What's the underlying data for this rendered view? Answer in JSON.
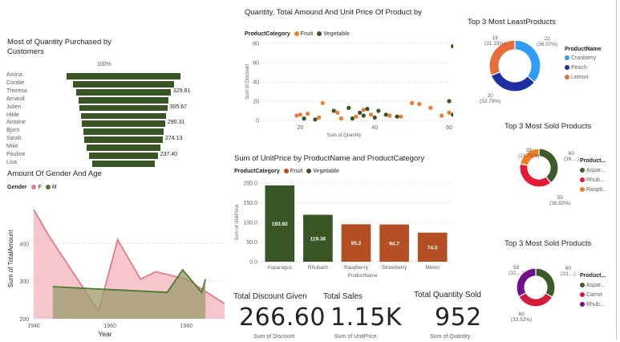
{
  "colors": {
    "dark_green": "#375623",
    "fruit": "#ed7d31",
    "vegetable": "#375623",
    "bar_green": "#375623",
    "bar_brown": "#b34f23",
    "area_f": "#e37c8a",
    "area_f_fill": "#f2b8c0",
    "area_m": "#4a7a2e",
    "cranberry": "#2e9df7",
    "peach": "#1f2ea0",
    "lemon": "#e86d3b",
    "asparagus": "#3b5b2b",
    "rhubarb": "#e31a38",
    "raspberry": "#f57d1f",
    "carrot": "#d61a3c",
    "rhubarb2": "#6f0f8a"
  },
  "funnel": {
    "title": "Most of Quantity Purchased by Customers",
    "top_label": "100%",
    "chart_data": {
      "type": "funnel",
      "categories": [
        "Amina",
        "Coralie",
        "Theresa",
        "Arnaud",
        "Julien",
        "Hilde",
        "Antoine",
        "Bjorn",
        "Sarah",
        "Mike",
        "Pauline",
        "Lisa"
      ],
      "values": [
        100,
        89,
        83,
        79,
        77,
        75,
        73,
        71,
        69,
        65,
        60,
        55
      ],
      "labels": [
        "",
        "",
        "329.81",
        "",
        "305.67",
        "",
        "290.31",
        "",
        "274.13",
        "",
        "237.40",
        ""
      ]
    }
  },
  "area": {
    "title": "Amount Of Gender And Age",
    "legend_title": "Gender",
    "legend": [
      "F",
      "M"
    ],
    "ylabel": "Sum of TotalAmount",
    "xlabel": "Year",
    "chart_data": {
      "type": "area",
      "xlim": [
        1940,
        1990
      ],
      "ylim": [
        200,
        520
      ],
      "x_ticks": [
        1940,
        1960,
        1980
      ],
      "y_ticks": [
        200,
        300,
        400
      ],
      "series": [
        {
          "name": "F",
          "x": [
            1940,
            1944,
            1957,
            1962,
            1968,
            1972,
            1980,
            1990
          ],
          "y": [
            490,
            420,
            220,
            410,
            305,
            325,
            305,
            240
          ]
        },
        {
          "name": "M",
          "x": [
            1945,
            1955,
            1975,
            1979,
            1984,
            1985
          ],
          "y": [
            285,
            280,
            270,
            330,
            270,
            305
          ]
        }
      ]
    }
  },
  "scatter": {
    "title": "Quantity, Total Amound And Unit Price Of Product by",
    "legend_title": "ProductCategory",
    "legend": [
      "Fruit",
      "Vegetable"
    ],
    "ylabel": "Sum of Discount",
    "xlabel": "Sum of Quantity",
    "chart_data": {
      "type": "scatter",
      "xlim": [
        10,
        60
      ],
      "ylim": [
        0,
        80
      ],
      "x_ticks": [
        20,
        40,
        60
      ],
      "y_ticks": [
        0,
        20,
        40,
        60,
        80
      ],
      "series": [
        {
          "name": "Fruit",
          "points": [
            [
              19,
              5
            ],
            [
              20,
              6
            ],
            [
              22,
              7
            ],
            [
              25,
              3
            ],
            [
              26,
              18
            ],
            [
              30,
              8
            ],
            [
              31,
              2
            ],
            [
              35,
              4
            ],
            [
              37,
              11
            ],
            [
              39,
              6
            ],
            [
              44,
              5
            ],
            [
              47,
              4
            ],
            [
              50,
              18
            ],
            [
              52,
              17
            ],
            [
              55,
              13
            ],
            [
              58,
              5
            ],
            [
              60,
              8
            ]
          ]
        },
        {
          "name": "Vegetable",
          "points": [
            [
              21,
              2
            ],
            [
              24,
              1
            ],
            [
              29,
              10
            ],
            [
              33,
              13
            ],
            [
              34,
              2
            ],
            [
              36,
              8
            ],
            [
              37,
              5
            ],
            [
              38,
              12
            ],
            [
              40,
              3
            ],
            [
              41,
              10
            ],
            [
              43,
              6
            ],
            [
              46,
              4
            ],
            [
              60,
              20
            ],
            [
              61,
              77
            ],
            [
              61,
              6
            ]
          ]
        }
      ]
    }
  },
  "bar": {
    "title": "Sum of UnitPrice by ProductName and ProductCategory",
    "legend_title": "ProductCategory",
    "legend": [
      "Fruit",
      "Vegetable"
    ],
    "ylabel": "Sum of UnitPrice",
    "xlabel": "ProductName",
    "chart_data": {
      "type": "bar",
      "categories": [
        "Asparagus",
        "Rhubarb",
        "Raspberry",
        "Strawberry",
        "Melon"
      ],
      "values": [
        193.92,
        119.36,
        95.2,
        94.7,
        74.0
      ],
      "value_labels": [
        "193.92",
        "119.36",
        "95.2",
        "94.7",
        "74.0"
      ],
      "category_type": [
        "Vegetable",
        "Vegetable",
        "Fruit",
        "Fruit",
        "Fruit"
      ],
      "ylim": [
        0,
        200
      ],
      "y_ticks": [
        "0.0",
        "50.0",
        "100.0",
        "150.0",
        "200.0"
      ]
    }
  },
  "kpis": [
    {
      "title": "Total Discount Given",
      "value": "266.60",
      "sub": "Sum of Discount"
    },
    {
      "title": "Total Sales",
      "value": "1.15K",
      "sub": "Sum of UnitPrice"
    },
    {
      "title": "Total Quantity Sold",
      "value": "952",
      "sub": "Sum of Quantity"
    }
  ],
  "donut_least": {
    "title": "Top 3 Most LeastProducts",
    "legend_title": "ProductName",
    "legend": [
      "Cranberry",
      "Peach",
      "Lemon"
    ],
    "labels": {
      "top_left_1": "19",
      "top_left_2": "(31.15%)",
      "top_right_1": "22",
      "top_right_2": "(36.07%)",
      "bottom_1": "20",
      "bottom_2": "(32.79%)"
    },
    "chart_data": {
      "type": "pie",
      "categories": [
        "Cranberry",
        "Peach",
        "Lemon"
      ],
      "values": [
        22,
        20,
        19
      ]
    }
  },
  "donut_sold1": {
    "title": "Top 3 Most Sold Products",
    "legend_title": "Product...",
    "legend": [
      "Aspar...",
      "Rhub...",
      "Raspb..."
    ],
    "labels": {
      "top_left_1": "33",
      "top_left_2": "(21.71%)",
      "top_right_1": "60",
      "top_right_2": "(39....)",
      "bottom_1": "59",
      "bottom_2": "(38.82%)"
    },
    "chart_data": {
      "type": "pie",
      "categories": [
        "Aspar...",
        "Rhub...",
        "Raspb..."
      ],
      "values": [
        60,
        59,
        33
      ]
    }
  },
  "donut_sold2": {
    "title": "Top 3 Most Sold Products",
    "legend_title": "Product...",
    "legend": [
      "Aspar...",
      "Carrot",
      "Rhub..."
    ],
    "labels": {
      "top_left_1": "59",
      "top_left_2": "(32....)",
      "top_right_1": "60",
      "top_right_2": "(33....)",
      "bottom_1": "60",
      "bottom_2": "(33.52%)"
    },
    "chart_data": {
      "type": "pie",
      "categories": [
        "Aspar...",
        "Carrot",
        "Rhub..."
      ],
      "values": [
        60,
        60,
        59
      ]
    }
  }
}
